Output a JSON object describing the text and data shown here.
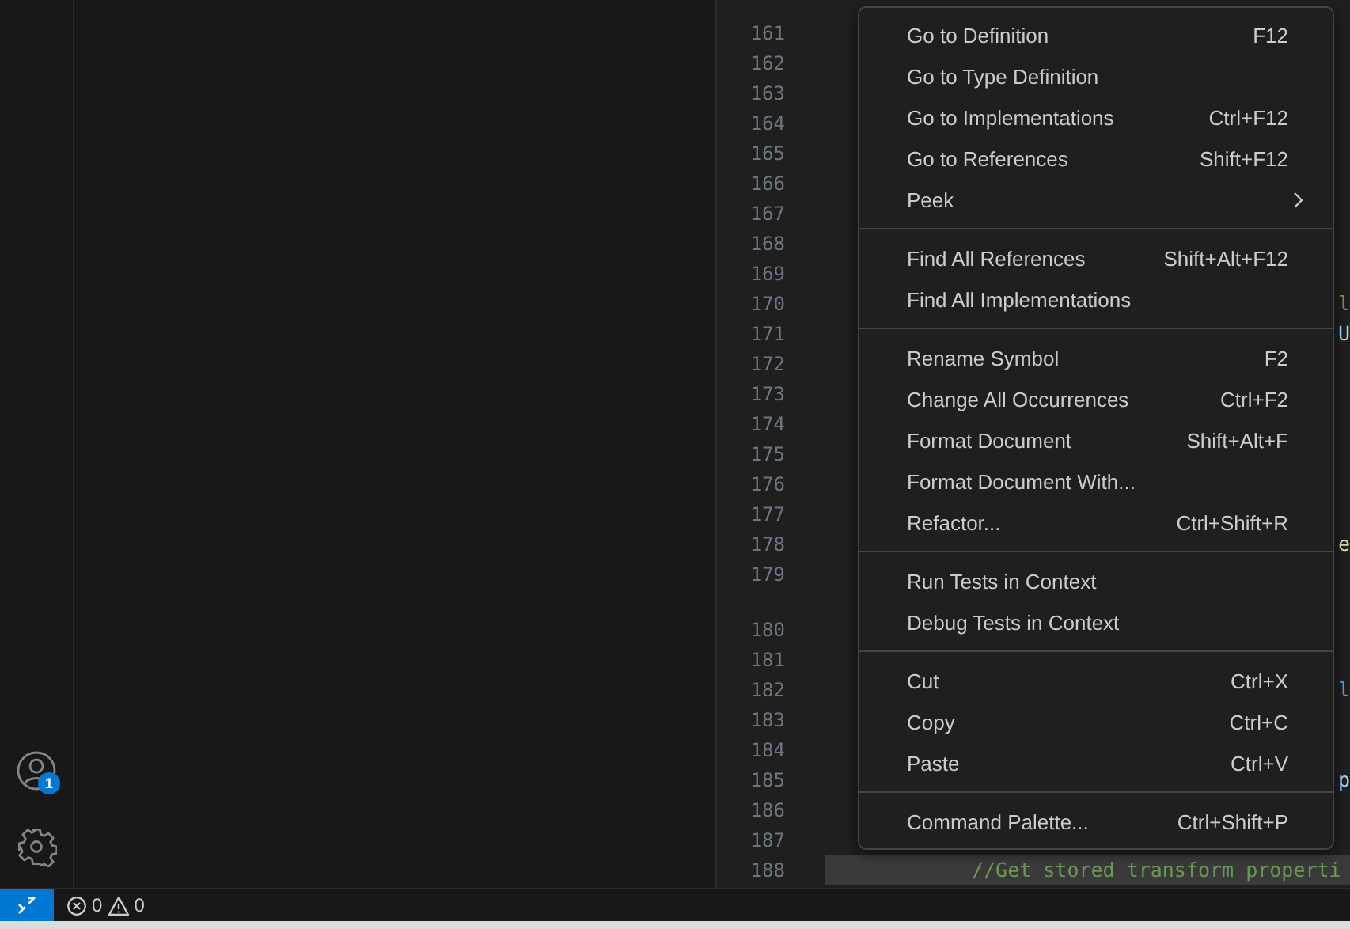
{
  "activity_bar": {
    "accounts_badge": "1"
  },
  "editor": {
    "lines_before": [
      {
        "number": "161"
      },
      {
        "number": "162"
      },
      {
        "number": "163"
      },
      {
        "number": "164"
      },
      {
        "number": "165"
      },
      {
        "number": "166"
      },
      {
        "number": "167"
      },
      {
        "number": "168"
      },
      {
        "number": "169"
      },
      {
        "number": "170",
        "text": "l",
        "color": "#6a9955"
      },
      {
        "number": "171",
        "text": "U",
        "color": "#9cdcfe"
      },
      {
        "number": "172"
      },
      {
        "number": "173"
      },
      {
        "number": "174"
      },
      {
        "number": "175"
      },
      {
        "number": "176"
      },
      {
        "number": "177"
      },
      {
        "number": "178",
        "text": "e",
        "color": "#dcdcaa"
      },
      {
        "number": "179"
      }
    ],
    "lines_after": [
      {
        "number": "180"
      },
      {
        "number": "181"
      },
      {
        "number": "182",
        "text": "l",
        "color": "#569cd6"
      },
      {
        "number": "183"
      },
      {
        "number": "184"
      },
      {
        "number": "185",
        "text": "p",
        "color": "#9cdcfe"
      },
      {
        "number": "186"
      },
      {
        "number": "187"
      },
      {
        "number": "188",
        "text": "//Get stored transform properti",
        "color": "#6a9955",
        "indented": true,
        "current": true
      }
    ]
  },
  "context_menu": {
    "groups": [
      [
        {
          "label": "Go to Definition",
          "shortcut": "F12",
          "submenu": false
        },
        {
          "label": "Go to Type Definition",
          "submenu": false
        },
        {
          "label": "Go to Implementations",
          "shortcut": "Ctrl+F12",
          "submenu": false
        },
        {
          "label": "Go to References",
          "shortcut": "Shift+F12",
          "submenu": false
        },
        {
          "label": "Peek",
          "submenu": true
        }
      ],
      [
        {
          "label": "Find All References",
          "shortcut": "Shift+Alt+F12",
          "submenu": false
        },
        {
          "label": "Find All Implementations",
          "submenu": false
        }
      ],
      [
        {
          "label": "Rename Symbol",
          "shortcut": "F2",
          "submenu": false
        },
        {
          "label": "Change All Occurrences",
          "shortcut": "Ctrl+F2",
          "submenu": false
        },
        {
          "label": "Format Document",
          "shortcut": "Shift+Alt+F",
          "submenu": false
        },
        {
          "label": "Format Document With...",
          "submenu": false
        },
        {
          "label": "Refactor...",
          "shortcut": "Ctrl+Shift+R",
          "submenu": false
        }
      ],
      [
        {
          "label": "Run Tests in Context",
          "submenu": false
        },
        {
          "label": "Debug Tests in Context",
          "submenu": false
        }
      ],
      [
        {
          "label": "Cut",
          "shortcut": "Ctrl+X",
          "submenu": false
        },
        {
          "label": "Copy",
          "shortcut": "Ctrl+C",
          "submenu": false
        },
        {
          "label": "Paste",
          "shortcut": "Ctrl+V",
          "submenu": false
        }
      ],
      [
        {
          "label": "Command Palette...",
          "shortcut": "Ctrl+Shift+P",
          "submenu": false
        }
      ]
    ]
  },
  "status_bar": {
    "errors": "0",
    "warnings": "0"
  }
}
